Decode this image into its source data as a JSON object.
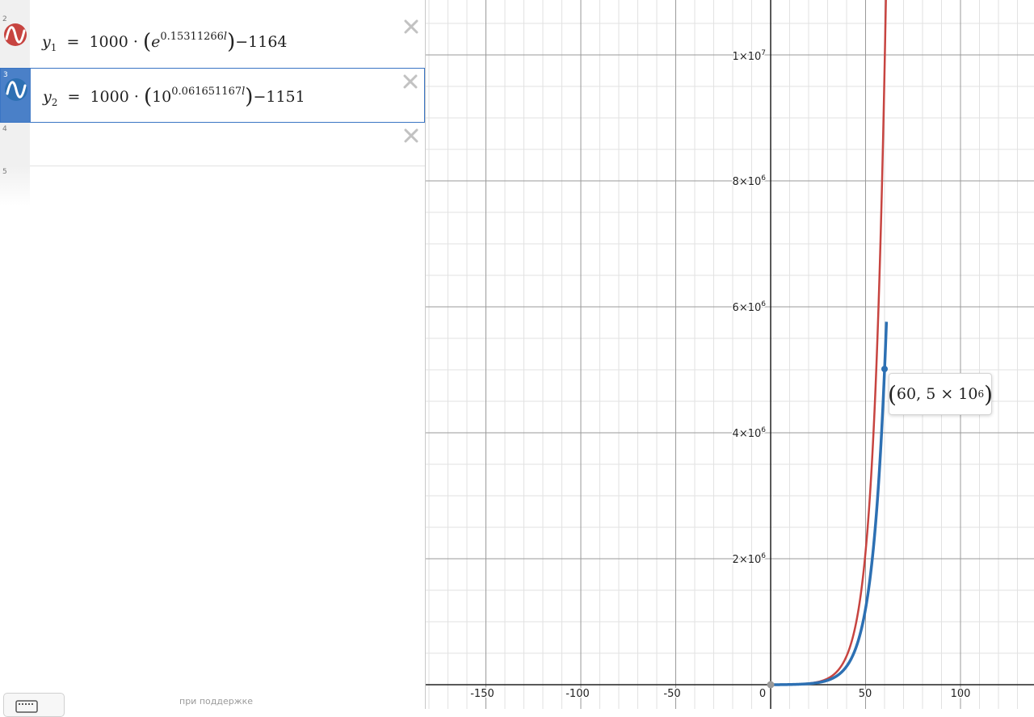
{
  "expressions": [
    {
      "num": "2",
      "color": "#c74440",
      "var": "y",
      "sub": "1",
      "coef": "1000",
      "base": "e",
      "exponent": "0.15311266",
      "param": "l",
      "offset": "−1164"
    },
    {
      "num": "3",
      "color": "#2d70b3",
      "var": "y",
      "sub": "2",
      "coef": "1000",
      "base": "10",
      "exponent": "0.061651167",
      "param": "l",
      "offset": "−1151"
    },
    {
      "num": "4"
    },
    {
      "num": "5"
    }
  ],
  "footer": {
    "powered_by": "при поддержке"
  },
  "graph": {
    "x_ticks": [
      "-150",
      "-100",
      "-50",
      "0",
      "50",
      "100"
    ],
    "y_ticks": [
      {
        "mant": "2×10",
        "exp": "6"
      },
      {
        "mant": "4×10",
        "exp": "6"
      },
      {
        "mant": "6×10",
        "exp": "6"
      },
      {
        "mant": "8×10",
        "exp": "6"
      },
      {
        "mant": "1×10",
        "exp": "7"
      }
    ],
    "point": {
      "x": "60",
      "y_mant": "5 × 10",
      "y_exp": "6"
    },
    "curve_colors": {
      "red": "#c74440",
      "blue": "#2d70b3"
    }
  }
}
